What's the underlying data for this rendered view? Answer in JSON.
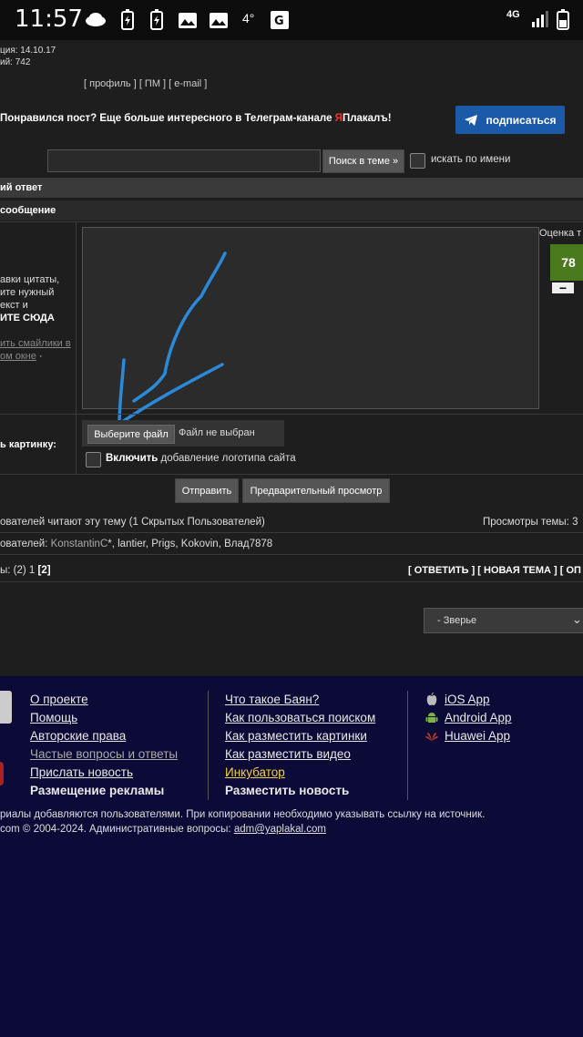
{
  "status_bar": {
    "time": "11:57",
    "network": "4G"
  },
  "header": {
    "reg_date": "ция: 14.10.17",
    "posts": "ий: 742",
    "links": "[ профиль ] [ ПМ ] [ e-mail ]"
  },
  "promo": {
    "text_before": "Понравился пост? Еще больше интересного в Телеграм-канале ",
    "ya": "Я",
    "text_after": "Плакалъ!",
    "subscribe_label": "подписаться"
  },
  "search": {
    "value": "",
    "button_label": "Поиск в теме »",
    "by_name_label": "искать по имени"
  },
  "reply": {
    "title": "ий ответ",
    "message_label": "сообщение",
    "quote_hint_1": "авки цитаты,",
    "quote_hint_2": "ите нужный",
    "quote_hint_3": "екст и",
    "quote_hint_4": "ИТЕ СЮДА",
    "smileys_1": "ить смайлики в",
    "smileys_2": "ом окне",
    "smileys_dot": " ·",
    "rating_label": "Оценка т",
    "rating_value": "78",
    "rating_minus": "−",
    "picture_label": "ь картинку:",
    "file_button": "Выберите файл",
    "file_status": "Файл не выбран",
    "logo_bold": "Включить",
    "logo_rest": " добавление логотипа сайта",
    "send_label": "Отправить",
    "preview_label": "Предварительный просмотр"
  },
  "readers": {
    "count_text": "ователей читают эту тему (1 Скрытых Пользователей)",
    "views_text": "Просмотры темы: 3",
    "users_prefix": "ователей: ",
    "user_highlight": "KonstantinC",
    "users_rest": "*, lantier, Prigs, Kokovin, Влад7878"
  },
  "pagination": {
    "prefix": "ы: (2) 1 ",
    "current": "[2]",
    "actions": "[ ОТВЕТИТЬ ] [ НОВАЯ ТЕМА ] [ ОП"
  },
  "jump": {
    "selected": "- Зверье"
  },
  "footer": {
    "col1": [
      "О проекте",
      "Помощь",
      "Авторские права",
      "Частые вопросы и ответы",
      "Прислать новость",
      "Размещение рекламы"
    ],
    "col2": [
      "Что такое Баян?",
      "Как пользоваться поиском",
      "Как разместить картинки",
      "Как разместить видео",
      "Инкубатор",
      "Разместить новость"
    ],
    "col3": [
      "iOS App",
      "Android App",
      "Huawei App"
    ],
    "copyright_1": "риалы добавляются пользователями. При копировании необходимо указывать ссылку на источник.",
    "copyright_2_prefix": "com © 2004-2024. Административные вопросы: ",
    "copyright_email": "adm@yaplakal.com"
  },
  "colors": {
    "footer_bg": "#0c0a36",
    "subscribe_bg": "#1a5aa8",
    "rating_bg": "#4b7a1e",
    "incubator": "#f0d040"
  }
}
